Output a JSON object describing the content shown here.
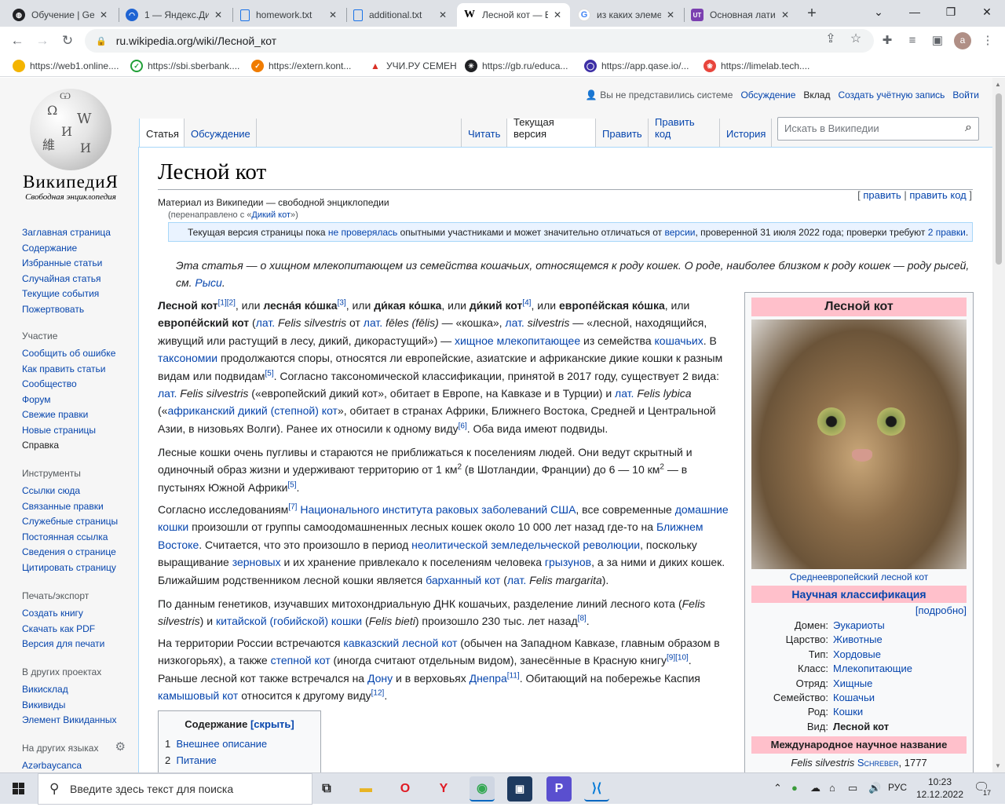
{
  "browser": {
    "tabs": [
      {
        "title": "Обучение | Ge",
        "favicon": "generic-globe-icon",
        "color": "#202124"
      },
      {
        "title": "1 — Яндекс.Ди",
        "favicon": "yandex-disk-icon",
        "color": "#1f64d3"
      },
      {
        "title": "homework.txt",
        "favicon": "document-icon",
        "color": "#1a73e8"
      },
      {
        "title": "additional.txt",
        "favicon": "document-icon",
        "color": "#1a73e8"
      },
      {
        "title": "Лесной кот — В",
        "favicon": "wikipedia-icon",
        "color": "#000000"
      },
      {
        "title": "из каких элеме",
        "favicon": "google-icon",
        "color": "#4285f4"
      },
      {
        "title": "Основная лати",
        "favicon": "ut-icon",
        "color": "#7b3fb0"
      }
    ],
    "address": "ru.wikipedia.org/wiki/Лесной_кот",
    "avatar_letter": "a",
    "bookmarks": [
      {
        "label": "https://web1.online....",
        "color": "#f4b400"
      },
      {
        "label": "https://sbi.sberbank....",
        "color": "#21a038"
      },
      {
        "label": "https://extern.kont...",
        "color": "#f07c00"
      },
      {
        "label": "УЧИ.РУ СЕМЕН",
        "color": "#d93025"
      },
      {
        "label": "https://gb.ru/educa...",
        "color": "#202124"
      },
      {
        "label": "https://app.qase.io/...",
        "color": "#3d2fa6"
      },
      {
        "label": "https://limelab.tech....",
        "color": "#e8453c"
      }
    ]
  },
  "wiki": {
    "logo_name": "ВикипедиЯ",
    "logo_tagline": "Свободная энциклопедия",
    "user_nav": {
      "anon": "Вы не представились системе",
      "talk": "Обсуждение",
      "contrib": "Вклад",
      "create": "Создать учётную запись",
      "login": "Войти"
    },
    "nav_main": [
      "Заглавная страница",
      "Содержание",
      "Избранные статьи",
      "Случайная статья",
      "Текущие события",
      "Пожертвовать"
    ],
    "participation_heading": "Участие",
    "participation": [
      "Сообщить об ошибке",
      "Как править статьи",
      "Сообщество",
      "Форум",
      "Свежие правки",
      "Новые страницы",
      "Справка"
    ],
    "tools_heading": "Инструменты",
    "tools": [
      "Ссылки сюда",
      "Связанные правки",
      "Служебные страницы",
      "Постоянная ссылка",
      "Сведения о странице",
      "Цитировать страницу"
    ],
    "print_heading": "Печать/экспорт",
    "print": [
      "Создать книгу",
      "Скачать как PDF",
      "Версия для печати"
    ],
    "projects_heading": "В других проектах",
    "projects": [
      "Викисклад",
      "Викивиды",
      "Элемент Викиданных"
    ],
    "languages_heading": "На других языках",
    "languages": [
      "Azərbaycanca"
    ],
    "tabs_left": [
      "Статья",
      "Обсуждение"
    ],
    "tabs_right": [
      "Читать",
      "Текущая версия",
      "Править",
      "Править код",
      "История"
    ],
    "search_placeholder": "Искать в Википедии",
    "title": "Лесной кот",
    "edit_section": {
      "open": "[ ",
      "edit": "править",
      "sep": " | ",
      "edit_source": "править код",
      "close": " ]"
    },
    "site_sub": "Материал из Википедии — свободной энциклопедии",
    "redirect": {
      "prefix": "(перенаправлено с «",
      "link": "Дикий кот",
      "suffix": "»)"
    },
    "flagged": {
      "a": "Текущая версия страницы пока ",
      "b": "не проверялась",
      "c": " опытными участниками и может значительно отличаться от ",
      "d": "версии",
      "e": ", проверенной 31 июля 2022 года; проверки требуют ",
      "f": "2 правки",
      "g": "."
    },
    "hatnote": {
      "a": "Эта статья — о хищном млекопитающем из семейства кошачьих, относящемся к роду кошек. О роде, наиболее близком к роду кошек — роду рысей, см. ",
      "b": "Рыси",
      "c": "."
    },
    "p1": {
      "t1": "Лесной кот",
      "s1": "[1]",
      "s2": "[2]",
      "t2": ", или ",
      "t3": "лесна́я ко́шка",
      "s3": "[3]",
      "t4": ", или ",
      "t5": "ди́кая ко́шка",
      "t6": ", или ",
      "t7": "ди́кий кот",
      "s4": "[4]",
      "t8": ", или ",
      "t9": "европе́йская ко́шка",
      "t10": ", или ",
      "t11": "европе́йский кот",
      "t12": " (",
      "l1": "лат.",
      "t13": " ",
      "t14": "Felis silvestris",
      "t15": " от ",
      "l2": "лат.",
      "t16": " ",
      "t17": "fēles (fēlis)",
      "t18": " — «кошка», ",
      "l3": "лат.",
      "t19": " ",
      "t20": "silvestris",
      "t21": " — «лесной, находящийся, живущий или растущий в лесу, дикий, дикорастущий») — ",
      "l4": "хищное млекопитающее",
      "t22": " из семейства ",
      "l5": "кошачьих",
      "t23": ". В ",
      "l6": "таксономии",
      "t24": " продолжаются споры, относятся ли европейские, азиатские и африканские дикие кошки к разным видам или подвидам",
      "s5": "[5]",
      "t25": ". Согласно таксономической классификации, принятой в 2017 году, существует 2 вида: ",
      "l7": "лат.",
      "t26": " ",
      "t27": "Felis silvestris",
      "t28": " («европейский дикий кот», обитает в Европе, на Кавказе и в Турции) и ",
      "l8": "лат.",
      "t29": " ",
      "t30": "Felis lybica",
      "t31": " («",
      "l9": "африканский дикий (степной) кот",
      "t32": "», обитает в странах Африки, Ближнего Востока, Средней и Центральной Азии, в низовьях Волги). Ранее их относили к одному виду",
      "s6": "[6]",
      "t33": ". Оба вида имеют подвиды."
    },
    "p2": {
      "t1": "Лесные кошки очень пугливы и стараются не приближаться к поселениям людей. Они ведут скрытный и одиночный образ жизни и удерживают территорию от 1 км",
      "sq1": "2",
      "t2": " (в Шотландии, Франции) до 6 — 10 км",
      "sq2": "2",
      "t3": " — в пустынях Южной Африки",
      "s1": "[5]",
      "t4": "."
    },
    "p3": {
      "t1": "Согласно исследованиям",
      "s1": "[7]",
      "t2": " ",
      "l1": "Национального института раковых заболеваний США",
      "t3": ", все современные ",
      "l2": "домашние кошки",
      "t4": " произошли от группы самоодомашненных лесных кошек около 10 000 лет назад где-то на ",
      "l3": "Ближнем Востоке",
      "t5": ". Считается, что это произошло в период ",
      "l4": "неолитической земледельческой революции",
      "t6": ", поскольку выращивание ",
      "l5": "зерновых",
      "t7": " и их хранение привлекало к поселениям человека ",
      "l6": "грызунов",
      "t8": ", а за ними и диких кошек. Ближайшим родственником лесной кошки является ",
      "l7": "барханный кот",
      "t9": " (",
      "l8": "лат.",
      "t10": " ",
      "t11": "Felis margarita",
      "t12": ")."
    },
    "p4": {
      "t1": "По данным генетиков, изучавших митохондриальную ДНК кошачьих, разделение линий лесного кота (",
      "t2": "Felis silvestris",
      "t3": ") и ",
      "l1": "китайской (гобийской) кошки",
      "t4": " (",
      "t5": "Felis bieti",
      "t6": ") произошло 230 тыс. лет назад",
      "s1": "[8]",
      "t7": "."
    },
    "p5": {
      "t1": "На территории России встречаются ",
      "l1": "кавказский лесной кот",
      "t2": " (обычен на Западном Кавказе, главным образом в низкогорьях), а также ",
      "l2": "степной кот",
      "t3": " (иногда считают отдельным видом), занесённые в Красную книгу",
      "s1": "[9]",
      "s2": "[10]",
      "t4": ". Раньше лесной кот также встречался на ",
      "l3": "Дону",
      "t5": " и в верховьях ",
      "l4": "Днепра",
      "s3": "[11]",
      "t6": ". Обитающий на побережье Каспия ",
      "l5": "камышовый кот",
      "t7": " относится к другому виду",
      "s4": "[12]",
      "t8": "."
    },
    "toc": {
      "title": "Содержание",
      "toggle": "[скрыть]",
      "items": [
        {
          "num": "1",
          "label": "Внешнее описание"
        },
        {
          "num": "2",
          "label": "Питание"
        }
      ]
    },
    "infobox": {
      "title": "Лесной кот",
      "caption": "Среднеевропейский лесной кот",
      "classification_heading": "Научная классификация",
      "taxobox_edit": "[подробно]",
      "rows": [
        {
          "key": "Домен:",
          "value": "Эукариоты",
          "link": true
        },
        {
          "key": "Царство:",
          "value": "Животные",
          "link": true
        },
        {
          "key": "Тип:",
          "value": "Хордовые",
          "link": true
        },
        {
          "key": "Класс:",
          "value": "Млекопитающие",
          "link": true
        },
        {
          "key": "Отряд:",
          "value": "Хищные",
          "link": true
        },
        {
          "key": "Семейство:",
          "value": "Кошачьи",
          "link": true
        },
        {
          "key": "Род:",
          "value": "Кошки",
          "link": true
        },
        {
          "key": "Вид:",
          "value": "Лесной кот",
          "link": false
        }
      ],
      "intl_heading": "Международное научное название",
      "intl_name": "Felis silvestris",
      "intl_author": "Schreber",
      "intl_year": ", 1777"
    }
  },
  "taskbar": {
    "search_placeholder": "Введите здесь текст для поиска",
    "lang": "РУС",
    "time": "10:23",
    "date": "12.12.2022",
    "notif_count": "17"
  }
}
